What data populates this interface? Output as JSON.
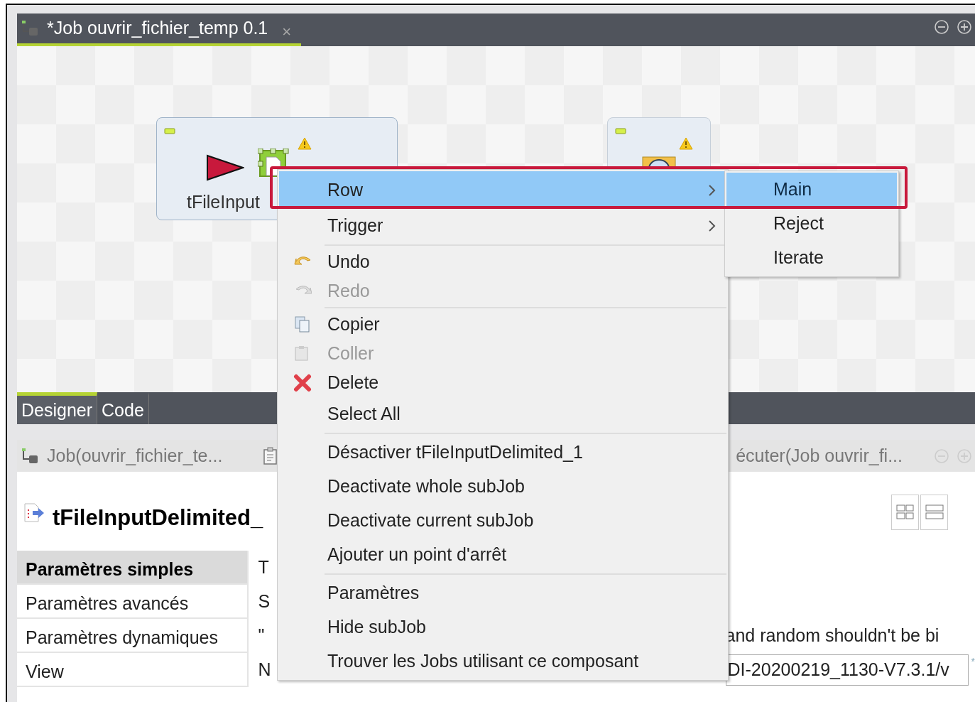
{
  "editor": {
    "tabs": [
      {
        "title": "*Job ouvrir_fichier_temp 0.1",
        "close": "×",
        "selected": true
      }
    ]
  },
  "canvas": {
    "components": [
      {
        "label": "tFileInput",
        "selected": true
      },
      {
        "selected": false
      }
    ]
  },
  "designer_tabs": [
    {
      "label": "Designer",
      "selected": true
    },
    {
      "label": "Code",
      "selected": false
    }
  ],
  "properties": {
    "tabs": [
      {
        "label": "Job(ouvrir_fichier_te..."
      },
      {
        "label": "écuter(Job ouvrir_fi..."
      }
    ],
    "title": "tFileInputDelimited_",
    "sections": [
      {
        "label": "Paramètres simples",
        "selected": true
      },
      {
        "label": "Paramètres avancés",
        "selected": false
      },
      {
        "label": "Paramètres dynamiques",
        "selected": false
      },
      {
        "label": "View",
        "selected": false
      }
    ],
    "rows": [
      {
        "label": "T"
      },
      {
        "label": "S"
      },
      {
        "label": "\"",
        "note": "and random shouldn't be bi"
      },
      {
        "label": "N",
        "value": "DI-20200219_1130-V7.3.1/v",
        "mark": "*"
      }
    ]
  },
  "context_menu": {
    "items": [
      {
        "kind": "submenu",
        "label": "Row",
        "selected": true,
        "disabled": false
      },
      {
        "kind": "submenu",
        "label": "Trigger",
        "selected": false,
        "disabled": false
      },
      {
        "kind": "separator"
      },
      {
        "kind": "undo",
        "label": "Undo",
        "selected": false,
        "disabled": false
      },
      {
        "kind": "redo",
        "label": "Redo",
        "selected": false,
        "disabled": true
      },
      {
        "kind": "separator"
      },
      {
        "kind": "copy",
        "label": "Copier",
        "selected": false,
        "disabled": false
      },
      {
        "kind": "paste",
        "label": "Coller",
        "selected": false,
        "disabled": true
      },
      {
        "kind": "delete",
        "label": "Delete",
        "selected": false,
        "disabled": false
      },
      {
        "kind": "plain",
        "label": "Select All",
        "selected": false,
        "disabled": false
      },
      {
        "kind": "separator"
      },
      {
        "kind": "plain",
        "label": "Désactiver tFileInputDelimited_1",
        "selected": false,
        "disabled": false
      },
      {
        "kind": "plain",
        "label": "Deactivate whole subJob",
        "selected": false,
        "disabled": false
      },
      {
        "kind": "plain",
        "label": "Deactivate current subJob",
        "selected": false,
        "disabled": false
      },
      {
        "kind": "plain",
        "label": "Ajouter un point d'arrêt",
        "selected": false,
        "disabled": false
      },
      {
        "kind": "separator"
      },
      {
        "kind": "plain",
        "label": "Paramètres",
        "selected": false,
        "disabled": false
      },
      {
        "kind": "plain",
        "label": "Hide subJob",
        "selected": false,
        "disabled": false
      },
      {
        "kind": "plain",
        "label": "Trouver les Jobs utilisant ce composant",
        "selected": false,
        "disabled": false
      }
    ],
    "submenu": [
      {
        "label": "Main",
        "selected": true
      },
      {
        "label": "Reject",
        "selected": false
      },
      {
        "label": "Iterate",
        "selected": false
      }
    ]
  }
}
